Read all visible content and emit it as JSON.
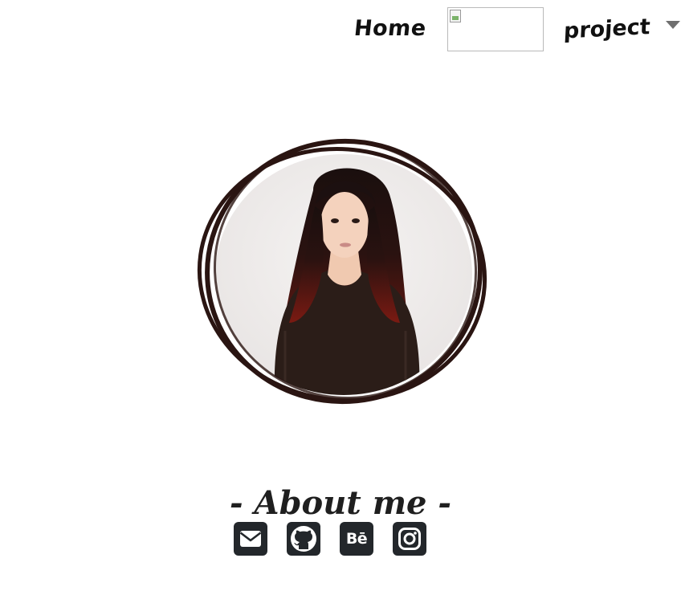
{
  "nav": {
    "home_label": "Home",
    "project_label": "project",
    "dropdown_icon": "caret-down-icon"
  },
  "about": {
    "title": "- About me -"
  },
  "socials": [
    {
      "icon": "envelope-icon"
    },
    {
      "icon": "github-icon"
    },
    {
      "icon": "behance-icon",
      "label": "Bē"
    },
    {
      "icon": "instagram-icon"
    }
  ],
  "colors": {
    "background": "#ffffff",
    "text": "#1f1f1f",
    "icon_bg": "#23272b",
    "ring": "#2a1512"
  }
}
